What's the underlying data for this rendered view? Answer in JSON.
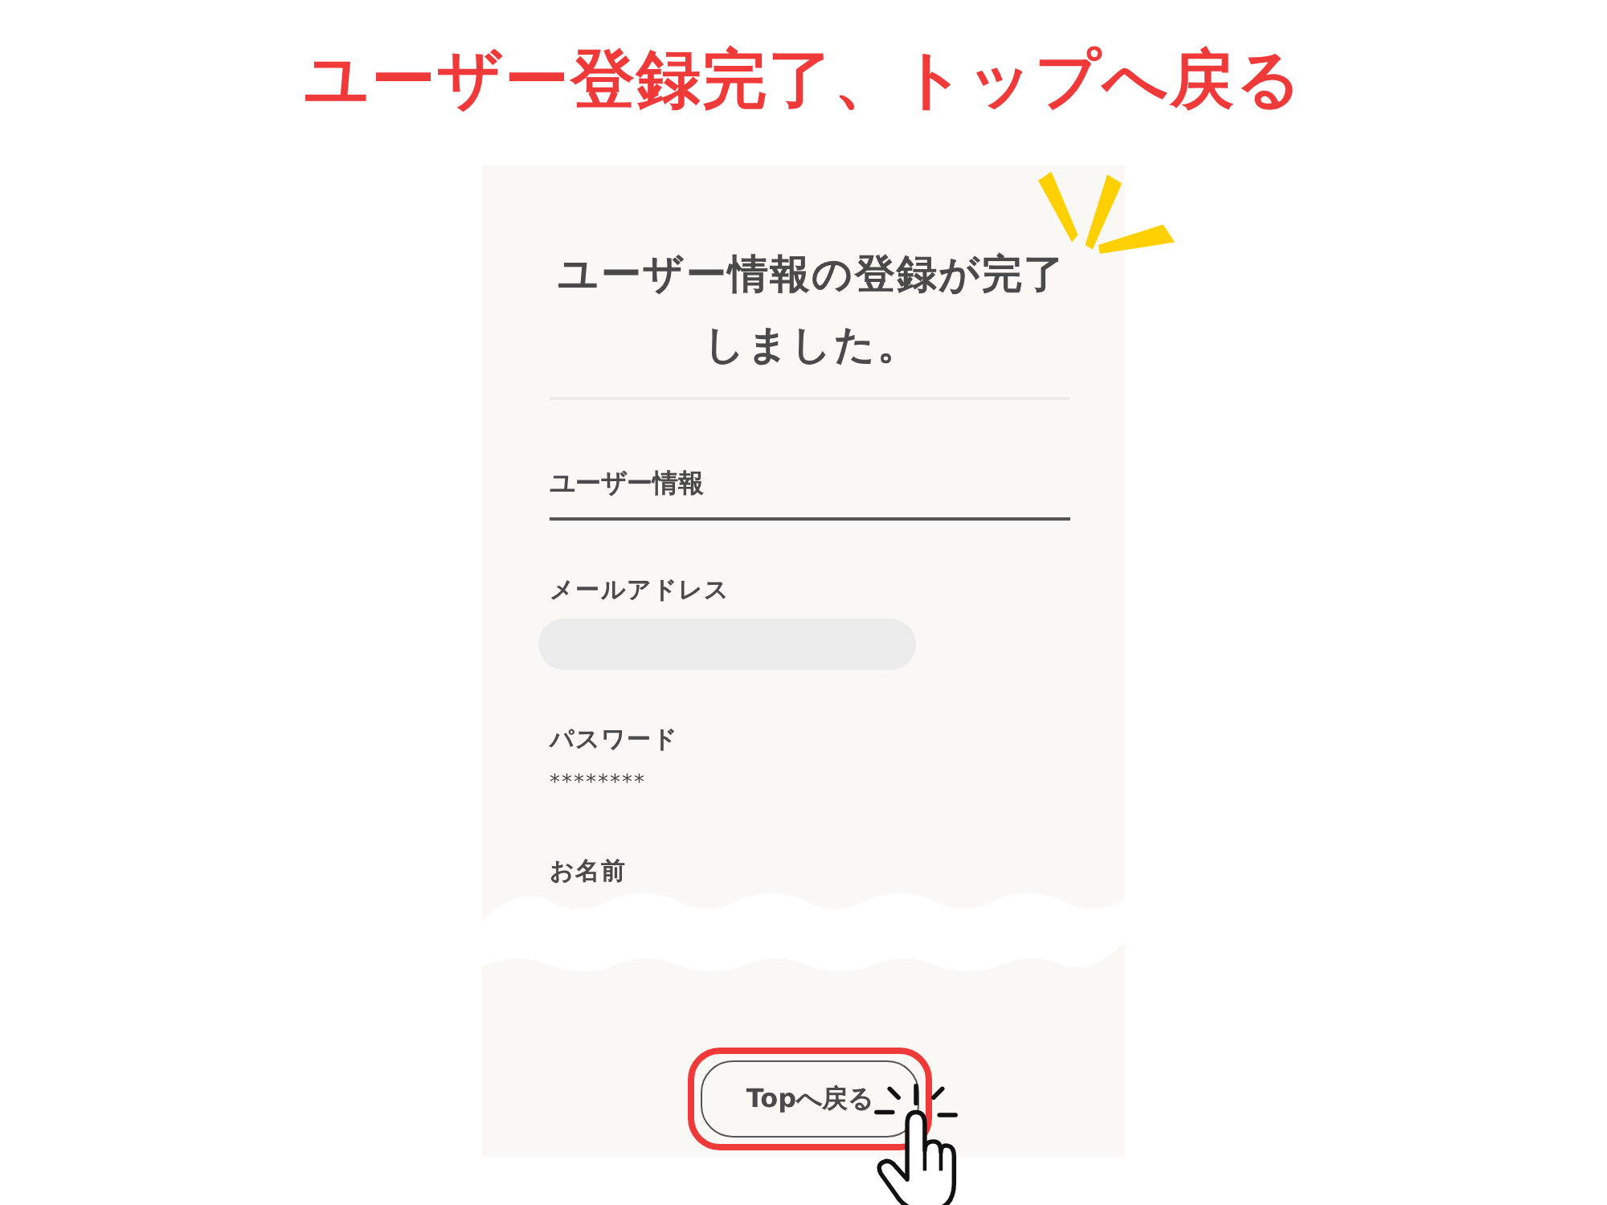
{
  "headline": "ユーザー登録完了、トップへ戻る",
  "screen": {
    "title": "ユーザー情報の登録が完了しました。",
    "section_heading": "ユーザー情報",
    "fields": [
      {
        "label": "メールアドレス",
        "kind": "redacted"
      },
      {
        "label": "パスワード",
        "kind": "text",
        "value": "********"
      },
      {
        "label": "お名前",
        "kind": "label_only"
      }
    ],
    "button": {
      "label": "Topへ戻る",
      "highlighted": true
    }
  }
}
